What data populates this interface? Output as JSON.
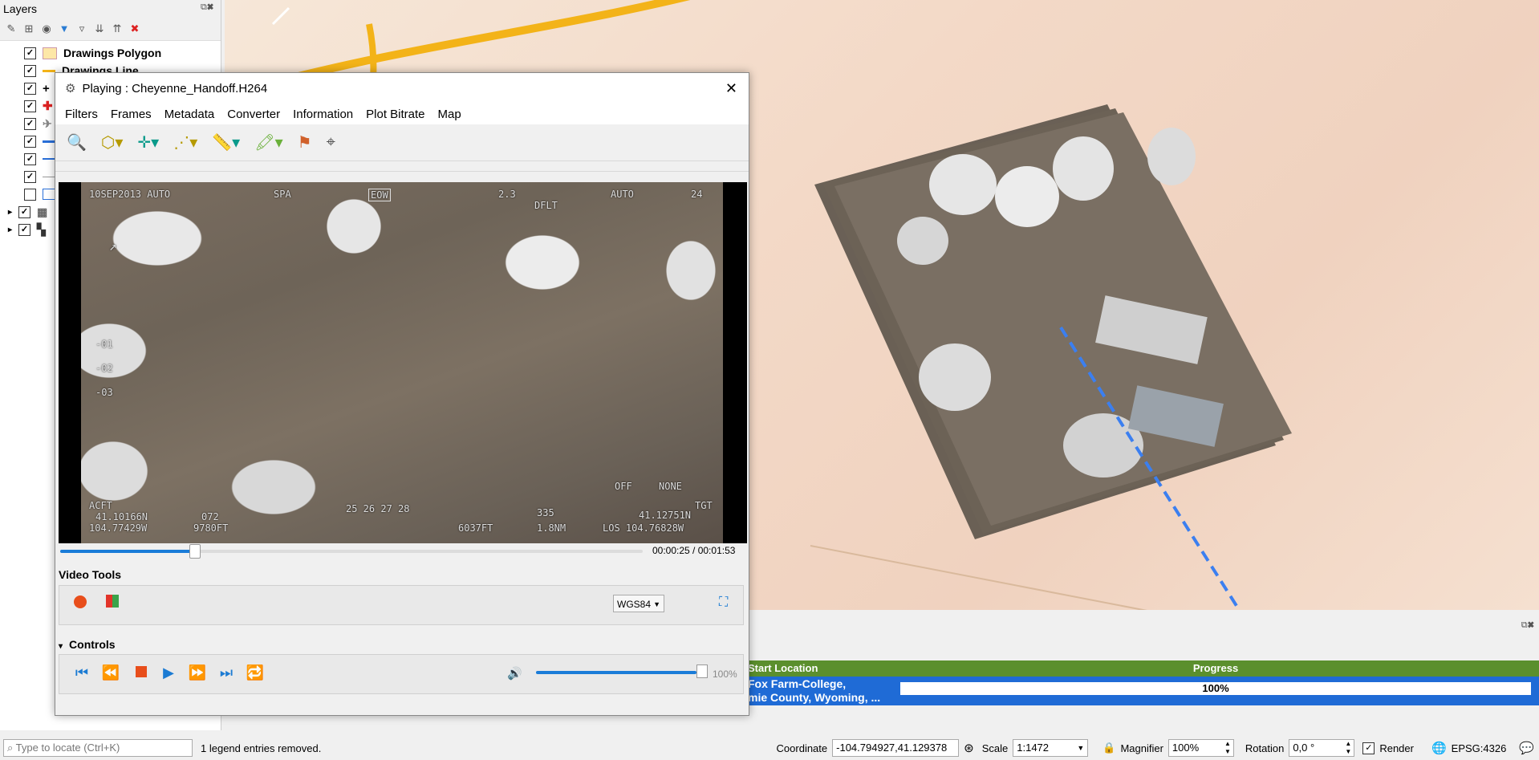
{
  "layers_panel": {
    "title": "Layers",
    "items": [
      {
        "label": "Drawings Polygon",
        "checked": true
      },
      {
        "label": "Drawings Line",
        "checked": true
      },
      {
        "label": "",
        "checked": true
      },
      {
        "label": "",
        "checked": true
      },
      {
        "label": "",
        "checked": true
      },
      {
        "label": "",
        "checked": true
      },
      {
        "label": "",
        "checked": true
      },
      {
        "label": "",
        "checked": true
      },
      {
        "label": "",
        "checked": false
      },
      {
        "label": "",
        "checked": true
      },
      {
        "label": "",
        "checked": true
      }
    ]
  },
  "video_window": {
    "title": "Playing : Cheyenne_Handoff.H264",
    "close_glyph": "✕",
    "menu": [
      "Filters",
      "Frames",
      "Metadata",
      "Converter",
      "Information",
      "Plot Bitrate",
      "Map"
    ],
    "osd": {
      "top_left": "10SEP2013 AUTO",
      "top_mid": "SPA",
      "top_box": "EOW",
      "top_right1": "2.3",
      "top_right2": "DFLT",
      "top_right3": "AUTO",
      "top_right4": "24",
      "scale1": "-01",
      "scale2": "-02",
      "scale3": "-03",
      "bottom_right_a": "OFF",
      "bottom_right_b": "NONE",
      "acft": "ACFT",
      "lat": "41.10166N",
      "lon": "104.77429W",
      "alt": "9780FT",
      "heading": "072",
      "ticks": "25 26 27 28",
      "tgt_alt": "6037FT",
      "range_deg": "335",
      "range_nm": "1.8NM",
      "los": "LOS 104.76828W",
      "tgt_lat": "41.12751N",
      "tgt": "TGT"
    },
    "progress": 0.23,
    "time": "00:00:25 / 00:01:53",
    "video_tools_label": "Video Tools",
    "crs_select": "WGS84",
    "controls_label": "Controls",
    "volume_pct": "100%",
    "volume": 1.0
  },
  "bottom_table": {
    "headers": [
      "Start Location",
      "Progress"
    ],
    "row": {
      "location_line1": "Fox Farm-College,",
      "location_line2": "mie County, Wyoming, ...",
      "progress_text": "100%",
      "progress": 1.0
    }
  },
  "status_bar": {
    "locate_placeholder": "Type to locate (Ctrl+K)",
    "message": "1 legend entries removed.",
    "coordinate_label": "Coordinate",
    "coordinate_value": "-104.794927,41.129378",
    "scale_label": "Scale",
    "scale_value": "1:1472",
    "magnifier_label": "Magnifier",
    "magnifier_value": "100%",
    "rotation_label": "Rotation",
    "rotation_value": "0,0 °",
    "render_label": "Render",
    "render_checked": true,
    "crs": "EPSG:4326"
  },
  "colors": {
    "accent": "#1a7cd8",
    "table_header": "#5b8f2d",
    "table_row": "#1f6bd6",
    "record": "#e84e1b"
  }
}
